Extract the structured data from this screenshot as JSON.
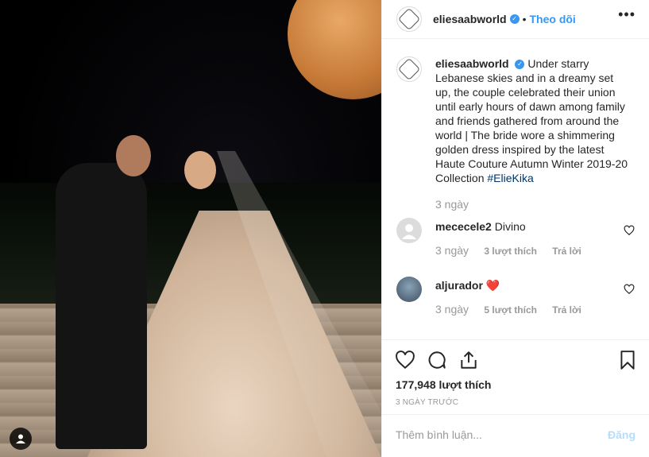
{
  "post": {
    "username": "eliesaabworld",
    "follow_separator": "•",
    "follow_label": "Theo dõi",
    "more_icon": "more-icon",
    "caption": {
      "text": "Under starry Lebanese skies and in a dreamy set up, the couple celebrated their union until early hours of dawn among family and friends gathered from around the world | The bride wore a shimmering golden dress inspired by the latest Haute Couture Autumn Winter 2019-20 Collection",
      "hashtag": "#ElieKika",
      "time": "3 ngày"
    },
    "comments": [
      {
        "username": "mececele2",
        "text": "Divino",
        "time": "3 ngày",
        "likes": "3 lượt thích",
        "reply": "Trả lời"
      },
      {
        "username": "aljurador",
        "text": "❤️",
        "time": "3 ngày",
        "likes": "5 lượt thích",
        "reply": "Trả lời"
      }
    ],
    "likes_count": "177,948 lượt thích",
    "posted": "3 NGÀY TRƯỚC",
    "add_comment_placeholder": "Thêm bình luận...",
    "post_button": "Đăng"
  },
  "colors": {
    "link_blue": "#3897f0",
    "hashtag": "#003569",
    "muted": "#999999",
    "post_disabled": "#b2dffc"
  }
}
